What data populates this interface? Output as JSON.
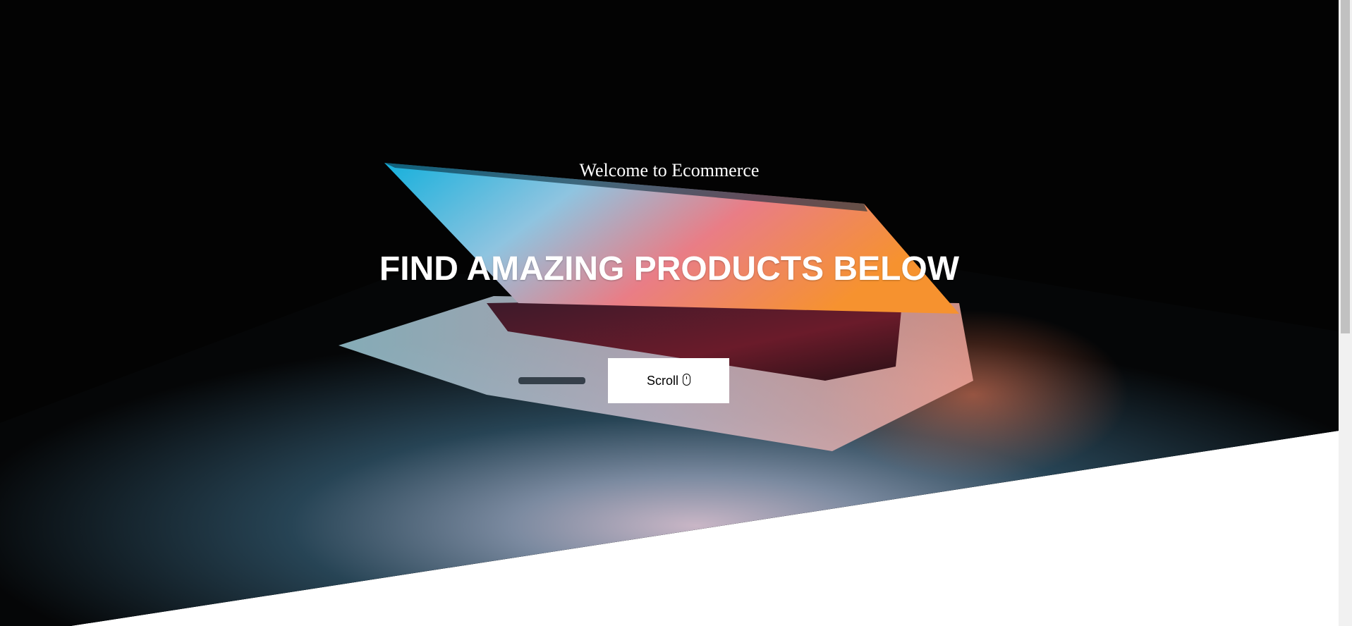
{
  "hero": {
    "welcome_text": "Welcome to Ecommerce",
    "headline": "FIND AMAZING PRODUCTS BELOW",
    "scroll_button_label": "Scroll",
    "scroll_icon": "mouse-icon",
    "background_image": "laptop-photo"
  },
  "colors": {
    "hero_background": "#030303",
    "text": "#ffffff",
    "button_background": "#ffffff",
    "button_text": "#000000",
    "page_background": "#ffffff"
  }
}
